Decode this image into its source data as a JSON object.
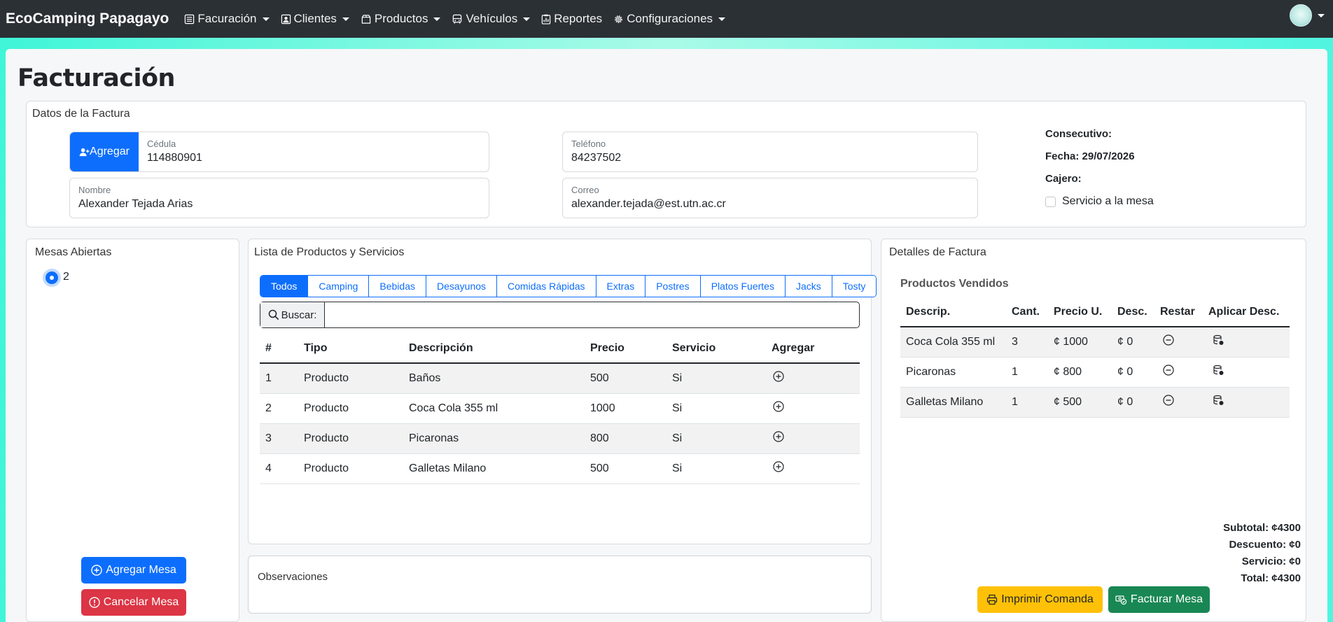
{
  "nav": {
    "brand": "EcoCamping Papagayo",
    "items": [
      {
        "label": "Facuración",
        "icon": "list-icon",
        "dropdown": true
      },
      {
        "label": "Clientes",
        "icon": "person-badge-icon",
        "dropdown": true
      },
      {
        "label": "Productos",
        "icon": "box-icon",
        "dropdown": true
      },
      {
        "label": "Vehículos",
        "icon": "bus-icon",
        "dropdown": true
      },
      {
        "label": "Reportes",
        "icon": "report-icon",
        "dropdown": false
      },
      {
        "label": "Configuraciones",
        "icon": "gear-icon",
        "dropdown": true
      }
    ]
  },
  "page": {
    "title": "Facturación"
  },
  "datos": {
    "title": "Datos de la Factura",
    "agregar_label": "Agregar",
    "cedula": {
      "label": "Cédula",
      "value": "114880901"
    },
    "telefono": {
      "label": "Teléfono",
      "value": "84237502"
    },
    "nombre": {
      "label": "Nombre",
      "value": "Alexander Tejada Arias"
    },
    "correo": {
      "label": "Correo",
      "value": "alexander.tejada@est.utn.ac.cr"
    },
    "consecutivo": "Consecutivo:",
    "fecha": "Fecha: 29/07/2026",
    "cajero": "Cajero:",
    "servicio_mesa": "Servicio a la mesa"
  },
  "mesas": {
    "title": "Mesas Abiertas",
    "items": [
      "2"
    ],
    "agregar_label": "Agregar Mesa",
    "cancelar_label": "Cancelar Mesa"
  },
  "productos": {
    "title": "Lista de Productos y Servicios",
    "tabs": [
      "Todos",
      "Camping",
      "Bebidas",
      "Desayunos",
      "Comidas Rápidas",
      "Extras",
      "Postres",
      "Platos Fuertes",
      "Jacks",
      "Tosty"
    ],
    "active_tab": "Todos",
    "search_label": "Buscar:",
    "search_value": "",
    "columns": [
      "#",
      "Tipo",
      "Descripción",
      "Precio",
      "Servicio",
      "Agregar"
    ],
    "rows": [
      [
        "1",
        "Producto",
        "Baños",
        "500",
        "Si"
      ],
      [
        "2",
        "Producto",
        "Coca Cola 355 ml",
        "1000",
        "Si"
      ],
      [
        "3",
        "Producto",
        "Picaronas",
        "800",
        "Si"
      ],
      [
        "4",
        "Producto",
        "Galletas Milano",
        "500",
        "Si"
      ]
    ]
  },
  "observaciones": {
    "label": "Observaciones"
  },
  "detalles": {
    "title": "Detalles de Factura",
    "subtitle": "Productos Vendidos",
    "columns": [
      "Descrip.",
      "Cant.",
      "Precio U.",
      "Desc.",
      "Restar",
      "Aplicar Desc."
    ],
    "rows": [
      [
        "Coca Cola 355 ml",
        "3",
        "¢ 1000",
        "¢ 0"
      ],
      [
        "Picaronas",
        "1",
        "¢ 800",
        "¢ 0"
      ],
      [
        "Galletas Milano",
        "1",
        "¢ 500",
        "¢ 0"
      ]
    ],
    "subtotal": "Subtotal: ¢4300",
    "descuento": "Descuento: ¢0",
    "servicio": "Servicio: ¢0",
    "total": "Total: ¢4300",
    "imprimir_label": "Imprimir Comanda",
    "facturar_label": "Facturar Mesa"
  },
  "colors": {
    "primary": "#0d6efd",
    "danger": "#dc3545",
    "warning": "#ffc107",
    "success": "#198754",
    "navbar": "#2b3035"
  }
}
